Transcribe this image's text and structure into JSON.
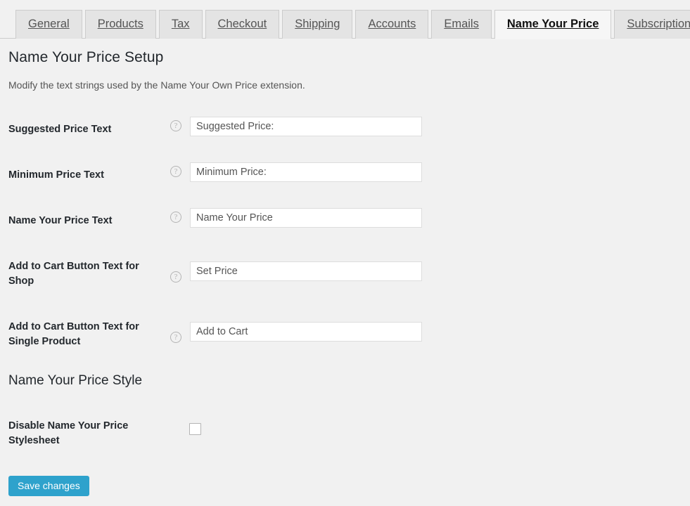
{
  "tabs": [
    {
      "label": "General",
      "active": false
    },
    {
      "label": "Products",
      "active": false
    },
    {
      "label": "Tax",
      "active": false
    },
    {
      "label": "Checkout",
      "active": false
    },
    {
      "label": "Shipping",
      "active": false
    },
    {
      "label": "Accounts",
      "active": false
    },
    {
      "label": "Emails",
      "active": false
    },
    {
      "label": "Name Your Price",
      "active": true
    },
    {
      "label": "Subscriptions",
      "active": false
    }
  ],
  "page": {
    "title": "Name Your Price Setup",
    "description": "Modify the text strings used by the Name Your Own Price extension."
  },
  "fields": [
    {
      "label": "Suggested Price Text",
      "value": "Suggested Price:",
      "help": "?"
    },
    {
      "label": "Minimum Price Text",
      "value": "Minimum Price:",
      "help": "?"
    },
    {
      "label": "Name Your Price Text",
      "value": "Name Your Price",
      "help": "?"
    },
    {
      "label": "Add to Cart Button Text for Shop",
      "value": "Set Price",
      "help": "?"
    },
    {
      "label": "Add to Cart Button Text for Single Product",
      "value": "Add to Cart",
      "help": "?"
    }
  ],
  "style_section": {
    "title": "Name Your Price Style",
    "checkbox_label": "Disable Name Your Price Stylesheet",
    "checked": false
  },
  "actions": {
    "save_label": "Save changes"
  },
  "colors": {
    "page_background": "#f1f1f1",
    "tab_background": "#e4e4e4",
    "tab_active_background": "#f6f6f6",
    "tab_border": "#cccccc",
    "heading_text": "#23282d",
    "body_text": "#555555",
    "input_border": "#dddddd",
    "input_background": "#ffffff",
    "help_icon": "#b4b4b4",
    "save_button": "#2ea2cc",
    "save_button_text": "#ffffff"
  }
}
